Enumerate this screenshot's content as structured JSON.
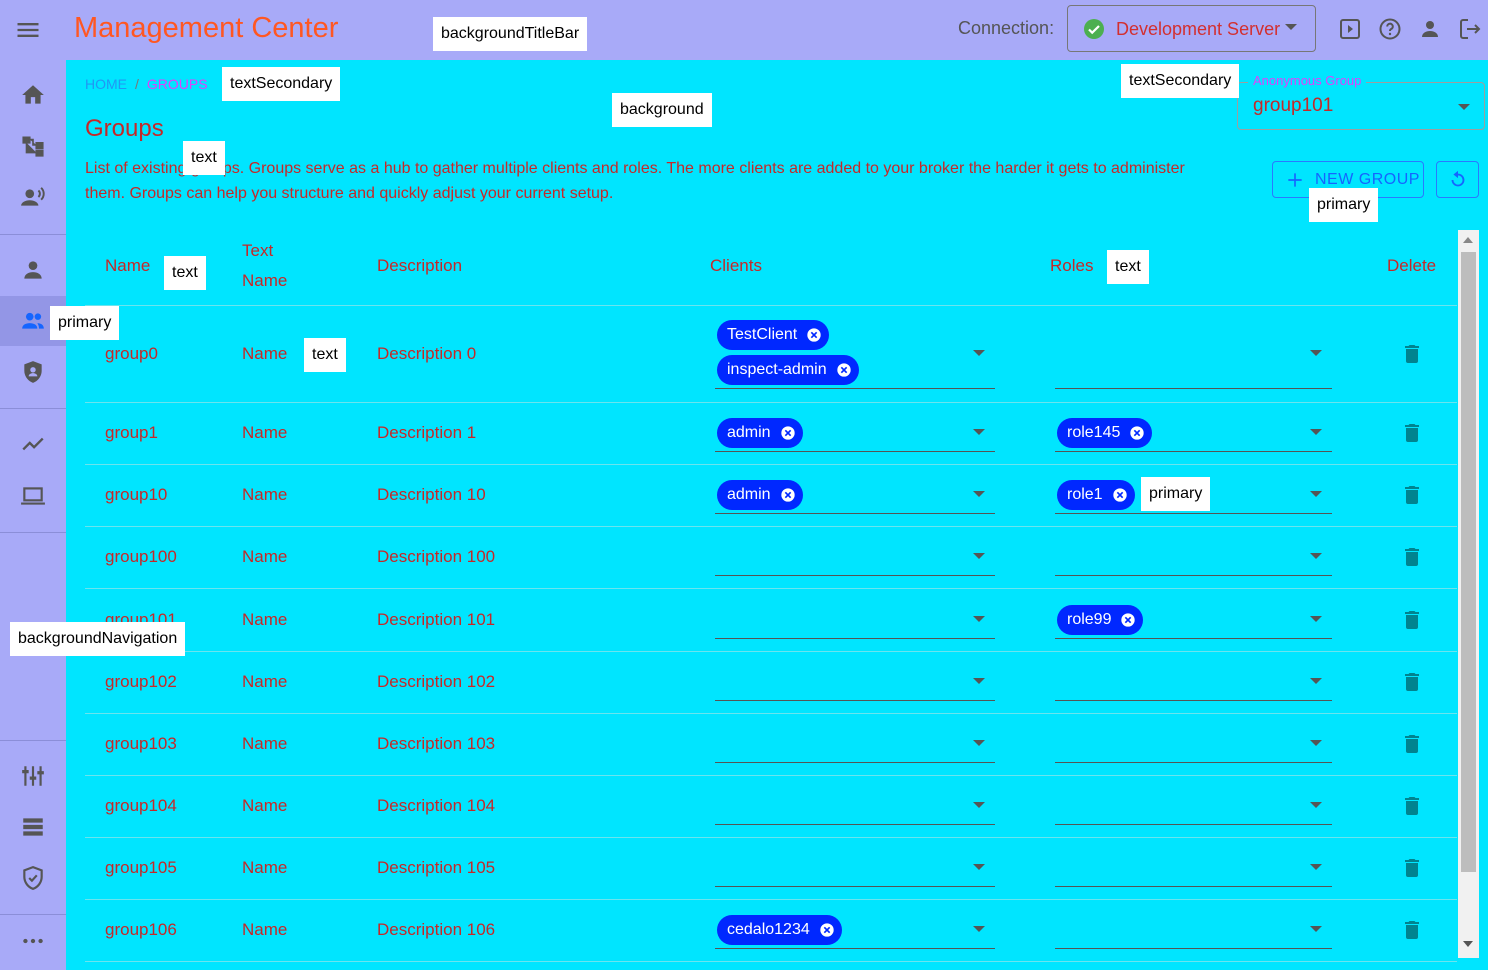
{
  "app": {
    "title": "Management Center"
  },
  "connection": {
    "label": "Connection:",
    "value": "Development Server"
  },
  "breadcrumb": {
    "home": "Home",
    "separator": "/",
    "current": "Groups"
  },
  "page": {
    "title": "Groups",
    "description": "List of existing groups. Groups serve as a hub to gather multiple clients and roles. The more clients are added to your broker the harder it gets to administer them. Groups can help you structure and quickly adjust your current setup."
  },
  "anonymous_group": {
    "label": "Anonymous Group",
    "value": "group101"
  },
  "actions": {
    "new_group": "New Group"
  },
  "table": {
    "headers": {
      "name": "Name",
      "text_name_1": "Text",
      "text_name_2": "Name",
      "description": "Description",
      "clients": "Clients",
      "roles": "Roles",
      "delete": "Delete"
    },
    "rows": [
      {
        "name": "group0",
        "text_name": "Name",
        "description": "Description 0",
        "clients": [
          "TestClient",
          "inspect-admin"
        ],
        "roles": []
      },
      {
        "name": "group1",
        "text_name": "Name",
        "description": "Description 1",
        "clients": [
          "admin"
        ],
        "roles": [
          "role145"
        ]
      },
      {
        "name": "group10",
        "text_name": "Name",
        "description": "Description 10",
        "clients": [
          "admin"
        ],
        "roles": [
          "role1"
        ]
      },
      {
        "name": "group100",
        "text_name": "Name",
        "description": "Description 100",
        "clients": [],
        "roles": []
      },
      {
        "name": "group101",
        "text_name": "Name",
        "description": "Description 101",
        "clients": [],
        "roles": [
          "role99"
        ]
      },
      {
        "name": "group102",
        "text_name": "Name",
        "description": "Description 102",
        "clients": [],
        "roles": []
      },
      {
        "name": "group103",
        "text_name": "Name",
        "description": "Description 103",
        "clients": [],
        "roles": []
      },
      {
        "name": "group104",
        "text_name": "Name",
        "description": "Description 104",
        "clients": [],
        "roles": []
      },
      {
        "name": "group105",
        "text_name": "Name",
        "description": "Description 105",
        "clients": [],
        "roles": []
      },
      {
        "name": "group106",
        "text_name": "Name",
        "description": "Description 106",
        "clients": [
          "cedalo1234"
        ],
        "roles": []
      }
    ]
  },
  "theme_labels": {
    "background_title_bar": "backgroundTitleBar",
    "text_secondary_1": "textSecondary",
    "text_secondary_2": "textSecondary",
    "background": "background",
    "text_desc": "text",
    "text_header_name": "text",
    "text_header_roles": "text",
    "text_cell": "text",
    "primary_nav": "primary",
    "primary_button": "primary",
    "primary_chip": "primary",
    "background_navigation": "backgroundNavigation"
  },
  "colors": {
    "title_bar": "#a8aaf8",
    "background": "#00e5ff",
    "title": "#ff5722",
    "text": "#c62828",
    "primary": "#0028ff",
    "text_secondary": "#e040fb"
  },
  "icons": {
    "nav": [
      "home-icon",
      "hierarchy-icon",
      "broadcast-icon",
      "person-icon",
      "groups-icon",
      "shield-icon",
      "chart-icon",
      "laptop-icon",
      "settings-icon",
      "list-icon",
      "security-icon",
      "more-icon"
    ],
    "title_bar": [
      "menu-icon",
      "tour-icon",
      "help-icon",
      "account-icon",
      "logout-icon"
    ]
  }
}
